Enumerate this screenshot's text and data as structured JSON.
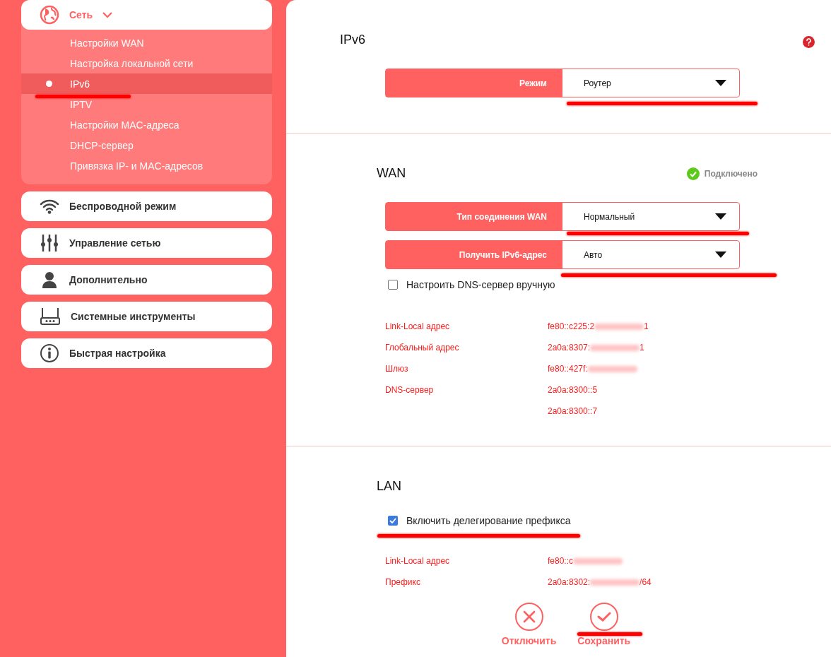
{
  "sidebar": {
    "menus": [
      {
        "label": "Сеть",
        "kind": "network",
        "expanded": true,
        "children": [
          {
            "label": "Настройки WAN",
            "selected": false
          },
          {
            "label": "Настройка локальной сети",
            "selected": false
          },
          {
            "label": "IPv6",
            "selected": true,
            "annotated": true
          },
          {
            "label": "IPTV",
            "selected": false
          },
          {
            "label": "Настройки MAC-адреса",
            "selected": false
          },
          {
            "label": "DHCP-сервер",
            "selected": false
          },
          {
            "label": "Привязка IP- и MAC-адресов",
            "selected": false
          }
        ]
      },
      {
        "label": "Беспроводной режим",
        "kind": "wireless",
        "expanded": false
      },
      {
        "label": "Управление сетью",
        "kind": "control",
        "expanded": false
      },
      {
        "label": "Дополнительно",
        "kind": "advanced",
        "expanded": false
      },
      {
        "label": "Системные инструменты",
        "kind": "tools",
        "expanded": false
      },
      {
        "label": "Быстрая настройка",
        "kind": "quick",
        "expanded": false
      }
    ]
  },
  "sections": [
    {
      "kind": "header",
      "title": "IPv6",
      "selects": [
        {
          "label": "Режим",
          "value": "Роутер",
          "annotated": true
        }
      ]
    },
    {
      "kind": "group",
      "title": "WAN",
      "status": {
        "text": "Подключено",
        "connected": true
      },
      "selects": [
        {
          "label": "Тип соединения WAN",
          "value": "Нормальный",
          "annotated": true
        },
        {
          "label": "Получить IPv6-адрес",
          "value": "Авто",
          "annotated": true
        }
      ],
      "checkboxes": [
        {
          "label": "Настроить DNS-сервер вручную",
          "checked": false
        }
      ],
      "info_rows": [
        {
          "label": "Link-Local адрес",
          "value": "fe80::c225:2",
          "value_end": "1",
          "redacted": true
        },
        {
          "label": "Глобальный адрес",
          "value": "2a0a:8307:",
          "value_end": "1",
          "redacted": true
        },
        {
          "label": "Шлюз",
          "value": "fe80::427f:",
          "redacted": true
        },
        {
          "label": "DNS-сервер",
          "value": "2a0a:8300::5",
          "redacted": false
        },
        {
          "value": "2a0a:8300::7",
          "redacted": false
        }
      ]
    },
    {
      "kind": "group",
      "title": "LAN",
      "checkboxes": [
        {
          "label": "Включить делегирование префикса",
          "checked": true,
          "annotated": true
        }
      ],
      "info_rows": [
        {
          "label": "Link-Local адрес",
          "value": "fe80::c",
          "redacted": true
        },
        {
          "label": "Префикс",
          "value": "2a0a:8302:",
          "value_end": "/64",
          "redacted": true
        }
      ],
      "actions": [
        {
          "kind": "cancel",
          "label": "Отключить"
        },
        {
          "kind": "save",
          "label": "Сохранить",
          "annotated": true
        }
      ]
    }
  ]
}
